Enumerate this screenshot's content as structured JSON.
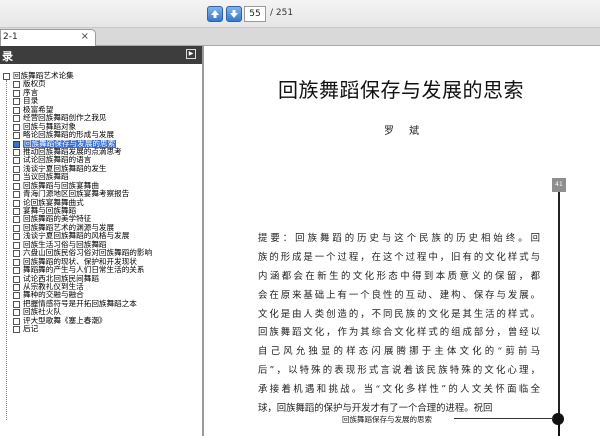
{
  "toolbar": {
    "current_page": "55",
    "total_pages": "/ 251",
    "prev_icon": "arrow-up-icon",
    "next_icon": "arrow-down-icon"
  },
  "tab": {
    "label": "2-1",
    "close": "×"
  },
  "sidebar": {
    "title": "录",
    "collapse_icon": "triangle-right-icon",
    "items": [
      {
        "label": "回族舞蹈艺术论集",
        "level": "root"
      },
      {
        "label": "版权页",
        "level": "child"
      },
      {
        "label": "序言",
        "level": "child"
      },
      {
        "label": "目录",
        "level": "child"
      },
      {
        "label": "极富希望",
        "level": "child"
      },
      {
        "label": "经营回族舞蹈创作之我见",
        "level": "child"
      },
      {
        "label": "回族与舞蹈对象",
        "level": "child"
      },
      {
        "label": "略论回族舞蹈的形成与发展",
        "level": "child"
      },
      {
        "label": "回族舞蹈保存与发展的思索",
        "level": "child",
        "active": true
      },
      {
        "label": "推动回族舞蹈发展的点滴思考",
        "level": "child"
      },
      {
        "label": "试论回族舞蹈的语言",
        "level": "child"
      },
      {
        "label": "浅谈宁夏回族舞蹈的发生",
        "level": "child"
      },
      {
        "label": "当议回族舞蹈",
        "level": "child"
      },
      {
        "label": "回族舞蹈与回族宴舞曲",
        "level": "child"
      },
      {
        "label": "青海门源地区回族宴舞考察报告",
        "level": "child"
      },
      {
        "label": "论回族宴舞舞曲式",
        "level": "child"
      },
      {
        "label": "宴舞与回族舞蹈",
        "level": "child"
      },
      {
        "label": "回族舞蹈的美学特征",
        "level": "child"
      },
      {
        "label": "回族舞蹈艺术的渊源与发展",
        "level": "child"
      },
      {
        "label": "浅谈宁夏回族舞蹈的风格与发展",
        "level": "child"
      },
      {
        "label": "回族生活习俗与回族舞蹈",
        "level": "child"
      },
      {
        "label": "六盘山回族民俗习俗对回族舞蹈的影响",
        "level": "child"
      },
      {
        "label": "回族舞蹈的现状、保护和开发现状",
        "level": "child"
      },
      {
        "label": "舞蹈舞的产生与人们日常生活的关系",
        "level": "child"
      },
      {
        "label": "试论西北回族民间舞蹈",
        "level": "child"
      },
      {
        "label": "从宗教礼仪到生活",
        "level": "child"
      },
      {
        "label": "舞种的交融与融合",
        "level": "child"
      },
      {
        "label": "把握情感符号是开拓回族舞蹈之本",
        "level": "child"
      },
      {
        "label": "回族社火队",
        "level": "child"
      },
      {
        "label": "评大型歌舞《塞上春潮》",
        "level": "child"
      },
      {
        "label": "后记",
        "level": "child"
      }
    ]
  },
  "document": {
    "title": "回族舞蹈保存与发展的思索",
    "author": "罗 斌",
    "page_marker": "41",
    "paragraph_lines": [
      "提要：回族舞蹈的历史与这个民族的历史相始终。回",
      "族的形成是一个过程，在这个过程中，旧有的文化样式与",
      "内涵都会在新生的文化形态中得到本质意义的保留，都",
      "会在原来基础上有一个良性的互动、建构、保存与发展。",
      "文化是由人类创造的，不同民族的文化是其生活的样式。",
      "回族舞蹈文化，作为其综合文化样式的组成部分，曾经以",
      "自己风允独显的样态闪展腾挪于主体文化的“剪前马",
      "后”，以特殊的表现形式言说着该民族特殊的文化心理，",
      "承接着机遇和挑战。当“文化多样性”的人文关怀面临全",
      "球，回族舞蹈的保护与开发才有了一个合理的进程。祝回"
    ],
    "footer": "回族舞蹈保存与发展的思索"
  }
}
